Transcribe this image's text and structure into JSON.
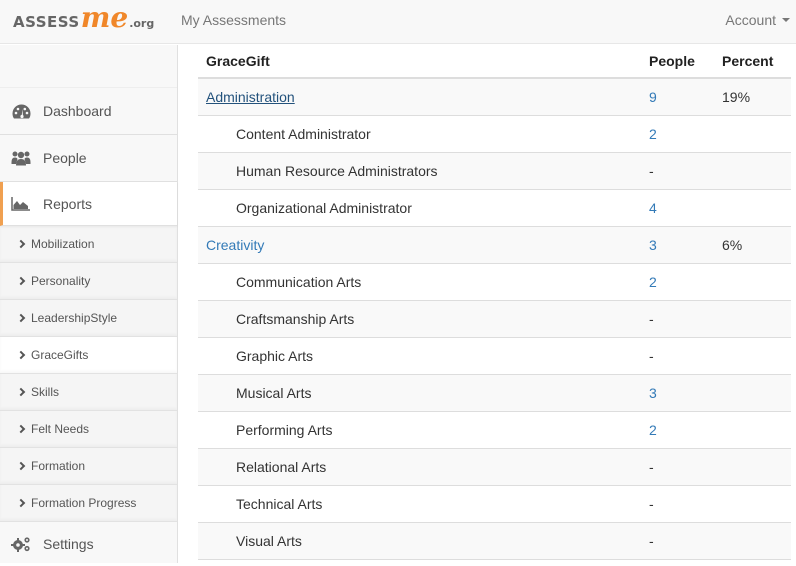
{
  "header": {
    "logo": {
      "part1": "ASSESS",
      "part2": "me",
      "part3": ".org"
    },
    "nav_link": "My Assessments",
    "account_label": "Account"
  },
  "sidebar": {
    "items": [
      {
        "label": "Dashboard",
        "icon": "dashboard-icon"
      },
      {
        "label": "People",
        "icon": "people-icon"
      },
      {
        "label": "Reports",
        "icon": "area-chart-icon",
        "active": true
      }
    ],
    "sub_items": [
      {
        "label": "Mobilization"
      },
      {
        "label": "Personality"
      },
      {
        "label": "LeadershipStyle"
      },
      {
        "label": "GraceGifts",
        "active": true
      },
      {
        "label": "Skills"
      },
      {
        "label": "Felt Needs"
      },
      {
        "label": "Formation"
      },
      {
        "label": "Formation Progress"
      }
    ],
    "settings": {
      "label": "Settings",
      "icon": "gears-icon"
    }
  },
  "table": {
    "headers": [
      "GraceGift",
      "People",
      "Percent"
    ],
    "rows": [
      {
        "name": "Administration",
        "people": "9",
        "percent": "19%",
        "type": "category",
        "hover": true
      },
      {
        "name": "Content Administrator",
        "people": "2",
        "percent": "",
        "type": "sub"
      },
      {
        "name": "Human Resource Administrators",
        "people": "-",
        "percent": "",
        "type": "sub"
      },
      {
        "name": "Organizational Administrator",
        "people": "4",
        "percent": "",
        "type": "sub"
      },
      {
        "name": "Creativity",
        "people": "3",
        "percent": "6%",
        "type": "category"
      },
      {
        "name": "Communication Arts",
        "people": "2",
        "percent": "",
        "type": "sub"
      },
      {
        "name": "Craftsmanship Arts",
        "people": "-",
        "percent": "",
        "type": "sub"
      },
      {
        "name": "Graphic Arts",
        "people": "-",
        "percent": "",
        "type": "sub"
      },
      {
        "name": "Musical Arts",
        "people": "3",
        "percent": "",
        "type": "sub"
      },
      {
        "name": "Performing Arts",
        "people": "2",
        "percent": "",
        "type": "sub"
      },
      {
        "name": "Relational Arts",
        "people": "-",
        "percent": "",
        "type": "sub"
      },
      {
        "name": "Technical Arts",
        "people": "-",
        "percent": "",
        "type": "sub"
      },
      {
        "name": "Visual Arts",
        "people": "-",
        "percent": "",
        "type": "sub"
      }
    ]
  },
  "colors": {
    "accent": "#f0872a",
    "link": "#337ab7",
    "link_hover": "#23527c"
  }
}
